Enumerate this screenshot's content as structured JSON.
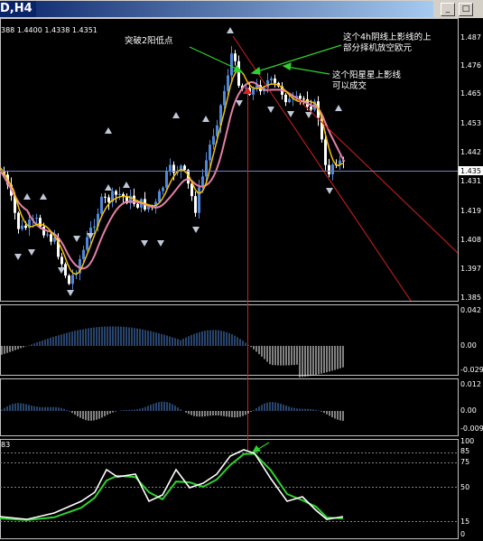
{
  "window": {
    "title": "D,H4",
    "min_icon": "minimize-icon",
    "max_icon": "maximize-icon",
    "min_glyph": "_",
    "max_glyph": "□"
  },
  "main_chart": {
    "ohlc_text": "388 1.4400 1.4338 1.4351",
    "price_labels": [
      "1.487",
      "1.476",
      "1.465",
      "1.453",
      "1.442",
      "1.431",
      "1.419",
      "1.408",
      "1.397",
      "1.385"
    ],
    "current_price": "1.435",
    "annotations": {
      "a1": "突破2阳低点",
      "a2_line1": "这个4h阴线上影线的上",
      "a2_line2": "部分择机放空欧元",
      "a3_line1": "这个阳星星上影线",
      "a3_line2": "可以成交"
    },
    "colors": {
      "up": "#4f88d8",
      "down": "#ffffff",
      "ma_fast": "#f5c000",
      "ma_slow": "#e57fa8",
      "trend": "#d42020",
      "arrow": "#30d030"
    }
  },
  "osc1": {
    "labels": [
      "0.042",
      "0.00",
      "-0.029"
    ]
  },
  "osc2": {
    "labels": [
      "0.012",
      "0.00",
      "-0.009"
    ]
  },
  "stoch": {
    "header": "83",
    "labels": [
      "100",
      "85",
      "75",
      "50",
      "15",
      "0"
    ],
    "colors": {
      "main": "#ffffff",
      "signal": "#30d030"
    }
  }
}
